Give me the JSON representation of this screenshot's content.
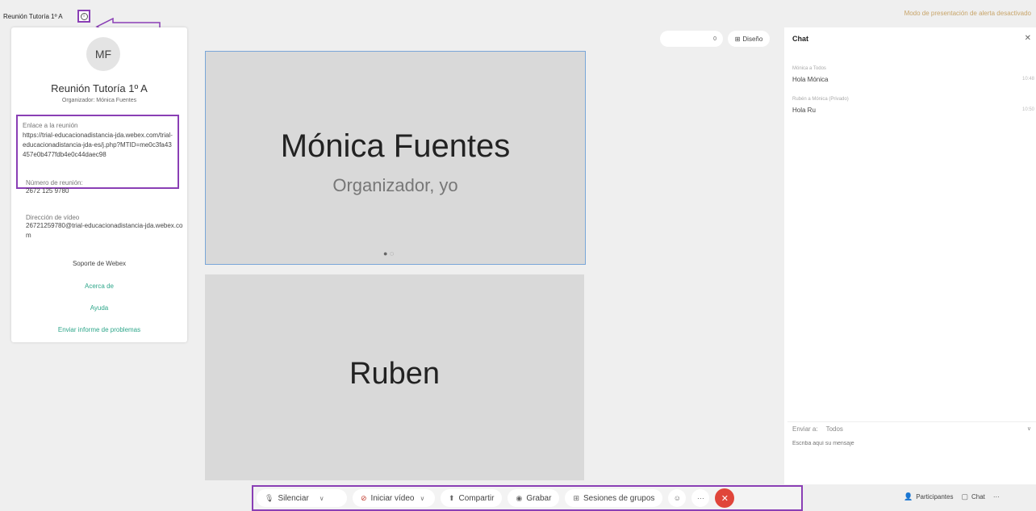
{
  "header": {
    "meeting_title": "Reunión Tutoría 1º A",
    "privacy_notice": "Modo de presentación de alerta desactivado"
  },
  "info_panel": {
    "avatar_initials": "MF",
    "title": "Reunión Tutoría 1º A",
    "organizer": "Organizador: Mónica Fuentes",
    "link_label": "Enlace a la reunión",
    "link_value": "https://trial-educacionadistancia-jda.webex.com/trial-educacionadistancia-jda-es/j.php?MTID=me0c3fa43457e0b477fdb4e0c44daec98",
    "meeting_number_label": "Número de reunión:",
    "meeting_number": "2672 125 9780",
    "video_address_label": "Dirección de vídeo",
    "video_address": "26721259780@trial-educacionadistancia-jda.webex.com",
    "support_title": "Soporte de Webex",
    "links": [
      "Acerca de",
      "Ayuda",
      "Enviar informe de problemas"
    ]
  },
  "view": {
    "zoom_label": "0",
    "layout_label": "Diseño"
  },
  "tiles": [
    {
      "name": "Mónica Fuentes",
      "role": "Organizador, yo"
    },
    {
      "name": "Ruben"
    }
  ],
  "chat": {
    "title": "Chat",
    "messages": [
      {
        "from": "Mónica a Todos",
        "text": "Hola Mónica",
        "time": "10:48"
      },
      {
        "from": "Rubén a Mónica (Privado)",
        "text": "Hola Ru",
        "time": "10:50"
      }
    ],
    "send_to_label": "Enviar a:",
    "send_to_value": "Todos",
    "input_placeholder": "Escriba aquí su mensaje"
  },
  "toolbar": {
    "mute": "Silenciar",
    "start_video": "Iniciar vídeo",
    "share": "Compartir",
    "record": "Grabar",
    "breakout": "Sesiones de grupos",
    "more": "···",
    "end": "✕"
  },
  "right_tools": {
    "participants": "Participantes",
    "chat": "Chat",
    "more": "···"
  },
  "colors": {
    "highlight": "#8a3fb5",
    "end_call": "#e0453a",
    "link_green": "#2ea68a"
  }
}
